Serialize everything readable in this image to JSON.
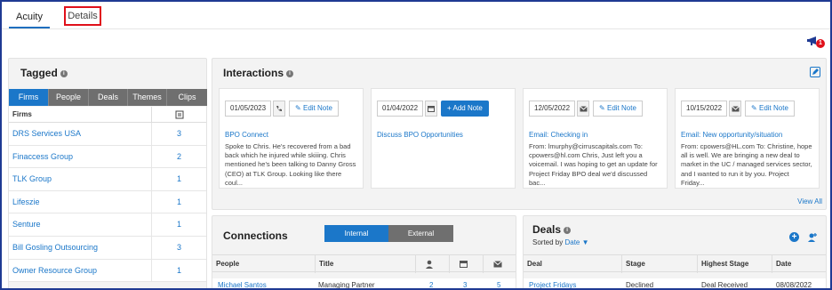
{
  "top_tabs": [
    {
      "label": "Acuity",
      "active": true
    },
    {
      "label": "Details",
      "active": false
    }
  ],
  "announce_badge": "1",
  "tagged": {
    "title": "Tagged",
    "tabs": [
      "Firms",
      "People",
      "Deals",
      "Themes",
      "Clips"
    ],
    "active_tab": "Firms",
    "column_header": "Firms",
    "rows": [
      {
        "name": "DRS Services USA",
        "count": "3"
      },
      {
        "name": "Finaccess Group",
        "count": "2"
      },
      {
        "name": "TLK Group",
        "count": "1"
      },
      {
        "name": "Lifeszie",
        "count": "1"
      },
      {
        "name": "Senture",
        "count": "1"
      },
      {
        "name": "Bill Gosling Outsourcing",
        "count": "3"
      },
      {
        "name": "Owner Resource Group",
        "count": "1"
      }
    ]
  },
  "interactions": {
    "title": "Interactions",
    "view_all": "View All",
    "cards": [
      {
        "date": "01/05/2023",
        "icon": "phone-icon",
        "button": "Edit Note",
        "subject": "BPO Connect",
        "body": "Spoke to Chris. He's recovered from a bad back which he injured while skiiing. Chris mentioned he's been talking to Danny Gross (CEO) at TLK Group. Looking like there coul..."
      },
      {
        "date": "01/04/2022",
        "icon": "calendar-icon",
        "button": "Add Note",
        "subject": "Discuss BPO Opportunities",
        "body": ""
      },
      {
        "date": "12/05/2022",
        "icon": "mail-icon",
        "button": "Edit Note",
        "subject": "Email: Checking in",
        "body": "From: lmurphy@cirruscapitals.com To: cpowers@hl.com Chris, Just left you a voicemail. I was hoping to get an update for Project Friday BPO deal we'd discussed bac..."
      },
      {
        "date": "10/15/2022",
        "icon": "mail-icon",
        "button": "Edit Note",
        "subject": "Email: New opportunity/situation",
        "body": "From: cpowers@HL.com To: Christine, hope all is well. We are bringing a new deal to market in the UC / managed services sector, and I wanted to run it by you. Project Friday..."
      }
    ]
  },
  "connections": {
    "title": "Connections",
    "segments": [
      "Internal",
      "External"
    ],
    "active_segment": "Internal",
    "columns": [
      "People",
      "Title"
    ],
    "rows": [
      {
        "person": "Michael Santos",
        "title": "Managing Partner",
        "c1": "2",
        "c2": "3",
        "c3": "5"
      }
    ]
  },
  "deals": {
    "title": "Deals",
    "sorted_by_label": "Sorted by",
    "sorted_by_value": "Date",
    "columns": [
      "Deal",
      "Stage",
      "Highest Stage",
      "Date"
    ],
    "rows": [
      {
        "deal": "Project Fridays",
        "stage": "Declined",
        "highest": "Deal Received",
        "date": "08/08/2022"
      }
    ]
  },
  "colors": {
    "accent": "#1b77c9",
    "tab_gray": "#6f6f6f",
    "highlight_red": "#e0101a",
    "frame_blue": "#1f3a93"
  }
}
